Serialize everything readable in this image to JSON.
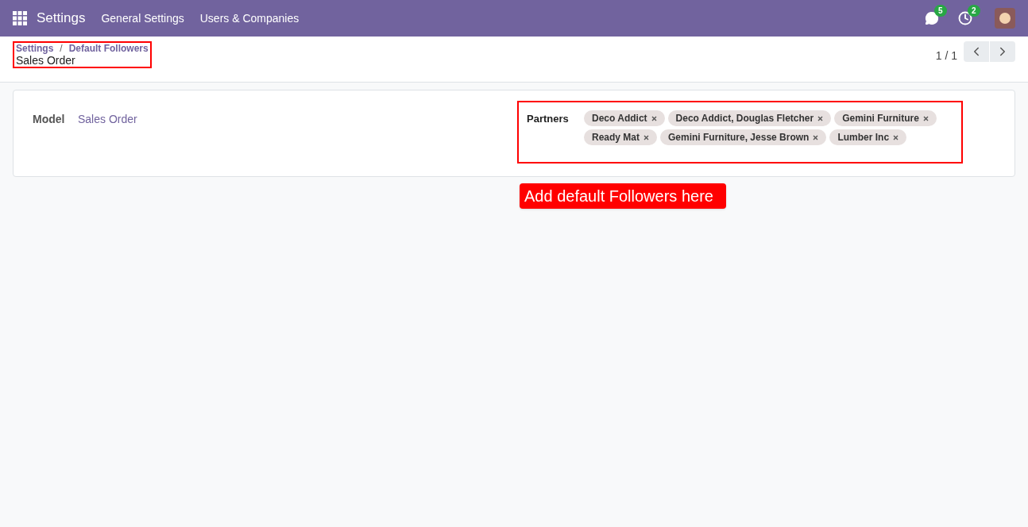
{
  "navbar": {
    "app_title": "Settings",
    "menu": [
      "General Settings",
      "Users & Companies"
    ],
    "messages_count": "5",
    "activities_count": "2"
  },
  "breadcrumb": {
    "items": [
      "Settings",
      "Default Followers"
    ],
    "separator": "/",
    "current": "Sales Order"
  },
  "pager": {
    "value": "1 / 1"
  },
  "form": {
    "model_label": "Model",
    "model_value": "Sales Order",
    "partners_label": "Partners",
    "partners": [
      {
        "name": "Deco Addict"
      },
      {
        "name": "Deco Addict, Douglas Fletcher"
      },
      {
        "name": "Gemini Furniture"
      },
      {
        "name": "Ready Mat"
      },
      {
        "name": "Gemini Furniture, Jesse Brown"
      },
      {
        "name": "Lumber Inc"
      }
    ]
  },
  "callout": "Add default Followers here"
}
